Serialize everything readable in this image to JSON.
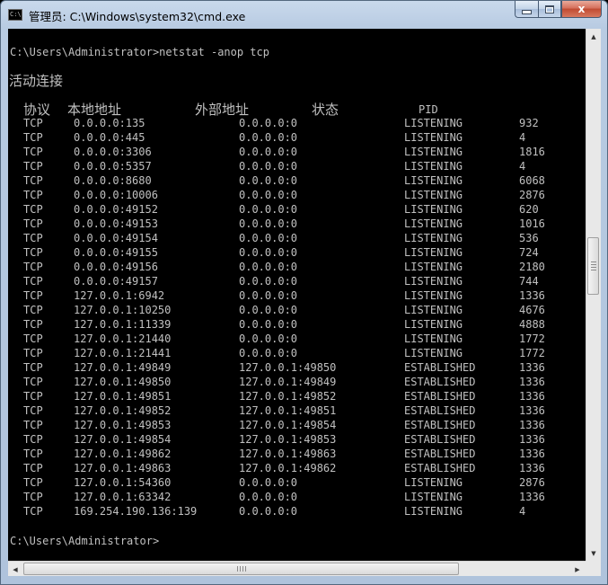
{
  "window": {
    "title": "管理员: C:\\Windows\\system32\\cmd.exe",
    "icon": "cmd-icon",
    "icon_text": "C:\\",
    "close_glyph": "x"
  },
  "console": {
    "command_line": "C:\\Users\\Administrator>netstat -anop tcp",
    "section_title": "活动连接",
    "headers": {
      "proto": "协议",
      "local": "本地地址",
      "foreign": "外部地址",
      "state": "状态",
      "pid": "PID"
    },
    "rows": [
      {
        "proto": "TCP",
        "local": "0.0.0.0:135",
        "foreign": "0.0.0.0:0",
        "state": "LISTENING",
        "pid": "932"
      },
      {
        "proto": "TCP",
        "local": "0.0.0.0:445",
        "foreign": "0.0.0.0:0",
        "state": "LISTENING",
        "pid": "4"
      },
      {
        "proto": "TCP",
        "local": "0.0.0.0:3306",
        "foreign": "0.0.0.0:0",
        "state": "LISTENING",
        "pid": "1816"
      },
      {
        "proto": "TCP",
        "local": "0.0.0.0:5357",
        "foreign": "0.0.0.0:0",
        "state": "LISTENING",
        "pid": "4"
      },
      {
        "proto": "TCP",
        "local": "0.0.0.0:8680",
        "foreign": "0.0.0.0:0",
        "state": "LISTENING",
        "pid": "6068"
      },
      {
        "proto": "TCP",
        "local": "0.0.0.0:10006",
        "foreign": "0.0.0.0:0",
        "state": "LISTENING",
        "pid": "2876"
      },
      {
        "proto": "TCP",
        "local": "0.0.0.0:49152",
        "foreign": "0.0.0.0:0",
        "state": "LISTENING",
        "pid": "620"
      },
      {
        "proto": "TCP",
        "local": "0.0.0.0:49153",
        "foreign": "0.0.0.0:0",
        "state": "LISTENING",
        "pid": "1016"
      },
      {
        "proto": "TCP",
        "local": "0.0.0.0:49154",
        "foreign": "0.0.0.0:0",
        "state": "LISTENING",
        "pid": "536"
      },
      {
        "proto": "TCP",
        "local": "0.0.0.0:49155",
        "foreign": "0.0.0.0:0",
        "state": "LISTENING",
        "pid": "724"
      },
      {
        "proto": "TCP",
        "local": "0.0.0.0:49156",
        "foreign": "0.0.0.0:0",
        "state": "LISTENING",
        "pid": "2180"
      },
      {
        "proto": "TCP",
        "local": "0.0.0.0:49157",
        "foreign": "0.0.0.0:0",
        "state": "LISTENING",
        "pid": "744"
      },
      {
        "proto": "TCP",
        "local": "127.0.0.1:6942",
        "foreign": "0.0.0.0:0",
        "state": "LISTENING",
        "pid": "1336"
      },
      {
        "proto": "TCP",
        "local": "127.0.0.1:10250",
        "foreign": "0.0.0.0:0",
        "state": "LISTENING",
        "pid": "4676"
      },
      {
        "proto": "TCP",
        "local": "127.0.0.1:11339",
        "foreign": "0.0.0.0:0",
        "state": "LISTENING",
        "pid": "4888"
      },
      {
        "proto": "TCP",
        "local": "127.0.0.1:21440",
        "foreign": "0.0.0.0:0",
        "state": "LISTENING",
        "pid": "1772"
      },
      {
        "proto": "TCP",
        "local": "127.0.0.1:21441",
        "foreign": "0.0.0.0:0",
        "state": "LISTENING",
        "pid": "1772"
      },
      {
        "proto": "TCP",
        "local": "127.0.0.1:49849",
        "foreign": "127.0.0.1:49850",
        "state": "ESTABLISHED",
        "pid": "1336"
      },
      {
        "proto": "TCP",
        "local": "127.0.0.1:49850",
        "foreign": "127.0.0.1:49849",
        "state": "ESTABLISHED",
        "pid": "1336"
      },
      {
        "proto": "TCP",
        "local": "127.0.0.1:49851",
        "foreign": "127.0.0.1:49852",
        "state": "ESTABLISHED",
        "pid": "1336"
      },
      {
        "proto": "TCP",
        "local": "127.0.0.1:49852",
        "foreign": "127.0.0.1:49851",
        "state": "ESTABLISHED",
        "pid": "1336"
      },
      {
        "proto": "TCP",
        "local": "127.0.0.1:49853",
        "foreign": "127.0.0.1:49854",
        "state": "ESTABLISHED",
        "pid": "1336"
      },
      {
        "proto": "TCP",
        "local": "127.0.0.1:49854",
        "foreign": "127.0.0.1:49853",
        "state": "ESTABLISHED",
        "pid": "1336"
      },
      {
        "proto": "TCP",
        "local": "127.0.0.1:49862",
        "foreign": "127.0.0.1:49863",
        "state": "ESTABLISHED",
        "pid": "1336"
      },
      {
        "proto": "TCP",
        "local": "127.0.0.1:49863",
        "foreign": "127.0.0.1:49862",
        "state": "ESTABLISHED",
        "pid": "1336"
      },
      {
        "proto": "TCP",
        "local": "127.0.0.1:54360",
        "foreign": "0.0.0.0:0",
        "state": "LISTENING",
        "pid": "2876"
      },
      {
        "proto": "TCP",
        "local": "127.0.0.1:63342",
        "foreign": "0.0.0.0:0",
        "state": "LISTENING",
        "pid": "1336"
      },
      {
        "proto": "TCP",
        "local": "169.254.190.136:139",
        "foreign": "0.0.0.0:0",
        "state": "LISTENING",
        "pid": "4"
      }
    ],
    "prompt": "C:\\Users\\Administrator>"
  },
  "colors": {
    "console_bg": "#000000",
    "console_fg": "#c0c0c0"
  },
  "scrollbars": {
    "vertical_up_icon": "arrow-up-icon",
    "vertical_down_icon": "arrow-down-icon",
    "horizontal_left_icon": "arrow-left-icon",
    "horizontal_right_icon": "arrow-right-icon"
  }
}
